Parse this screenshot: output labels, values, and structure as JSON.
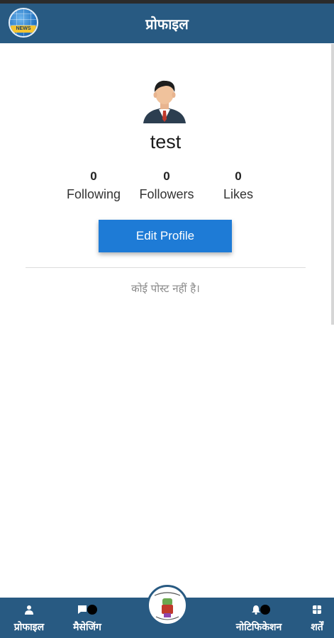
{
  "header": {
    "title": "प्रोफाइल",
    "logo_text": "NEWS"
  },
  "profile": {
    "username": "test",
    "stats": [
      {
        "count": "0",
        "label": "Following"
      },
      {
        "count": "0",
        "label": "Followers"
      },
      {
        "count": "0",
        "label": "Likes"
      }
    ],
    "edit_button": "Edit Profile",
    "empty_message": "कोई पोस्ट नहीं है।"
  },
  "bottom_nav": {
    "items": [
      {
        "label": "प्रोफाइल",
        "icon": "person-icon"
      },
      {
        "label": "मैसेजिंग",
        "icon": "message-icon"
      },
      {
        "label": "नोटिफिकेशन",
        "icon": "bell-icon"
      },
      {
        "label": "शर्तें",
        "icon": "grid-icon"
      }
    ],
    "center_icon": "app-logo-icon"
  },
  "colors": {
    "primary": "#285a82",
    "button": "#1e7bd6"
  }
}
